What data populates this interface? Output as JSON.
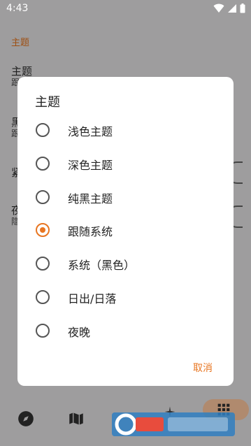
{
  "status_bar": {
    "time": "4:43",
    "icons": [
      "wifi-icon",
      "signal-icon",
      "battery-icon"
    ]
  },
  "background_screen": {
    "section_header": "主题",
    "rows": [
      {
        "title": "主题",
        "subtitle": "跟"
      },
      {
        "title": "黑",
        "subtitle": "跟"
      },
      {
        "title": "紧",
        "subtitle": ""
      },
      {
        "title": "夜",
        "subtitle": "隐"
      }
    ],
    "nav_icons": [
      "compass-icon",
      "map-icon",
      "sparkle-icon",
      "grid-icon"
    ]
  },
  "dialog": {
    "title": "主题",
    "options": [
      {
        "label": "浅色主题",
        "selected": false
      },
      {
        "label": "深色主题",
        "selected": false
      },
      {
        "label": "纯黑主题",
        "selected": false
      },
      {
        "label": "跟随系统",
        "selected": true
      },
      {
        "label": "系统（黑色）",
        "selected": false
      },
      {
        "label": "日出/日落",
        "selected": false
      },
      {
        "label": "夜晚",
        "selected": false
      }
    ],
    "cancel_label": "取消"
  },
  "colors": {
    "accent": "#e87622",
    "scrim_background": "#9e9d9e",
    "dialog_background": "#ffffff"
  }
}
